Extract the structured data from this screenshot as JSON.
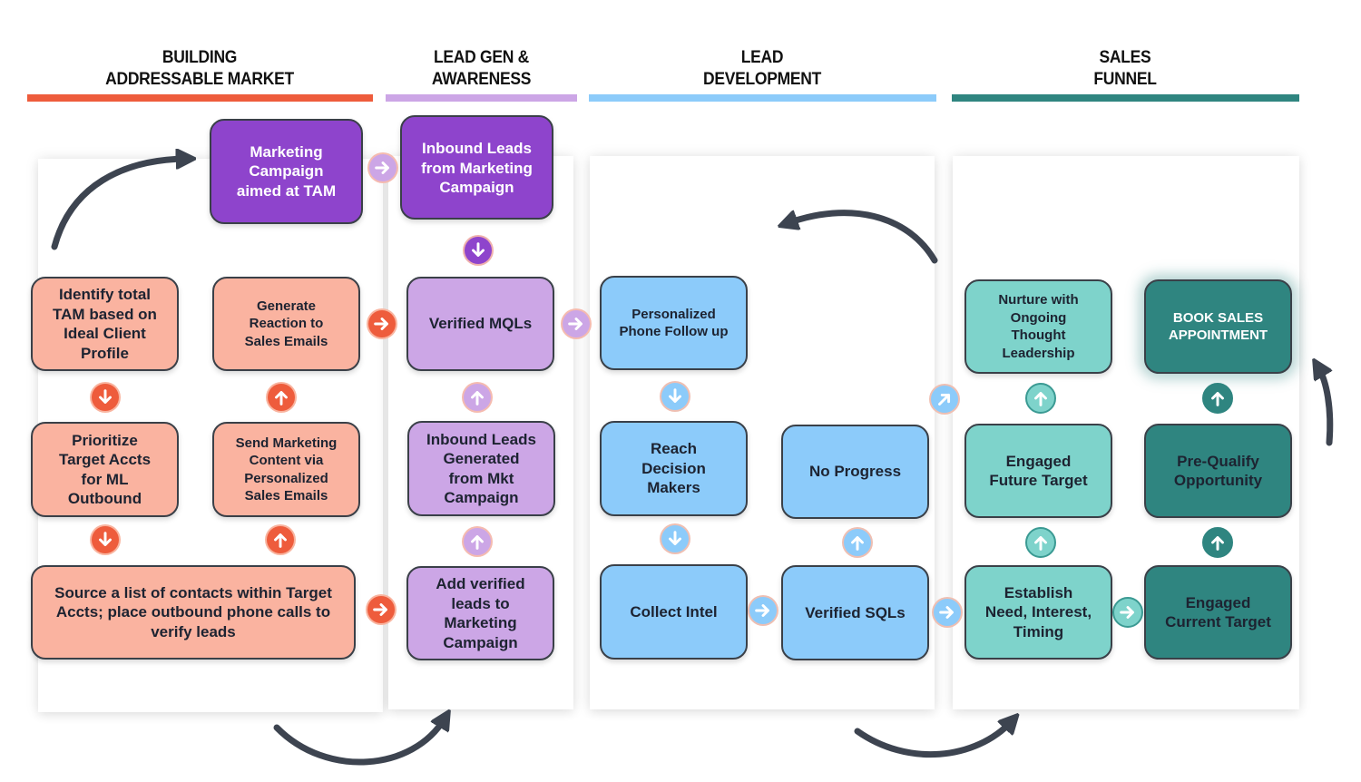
{
  "colors": {
    "stage1": "#EE5C3C",
    "stage2": "#CCA6E6",
    "stage3": "#8CCBFA",
    "stage4": "#2F8580",
    "salmon_box": "#FAB3A0",
    "purple_box": "#8E44CC",
    "light_purple_box": "#CCA6E6",
    "blue_box": "#8CCBFA",
    "light_teal_box": "#7ED3CB",
    "dark_teal_box": "#2F8580",
    "curve_arrow": "#3D4450"
  },
  "stages": [
    {
      "line1": "BUILDING",
      "line2": "ADDRESSABLE MARKET"
    },
    {
      "line1": "LEAD GEN &",
      "line2": "AWARENESS"
    },
    {
      "line1": "LEAD",
      "line2": "DEVELOPMENT"
    },
    {
      "line1": "SALES",
      "line2": "FUNNEL"
    }
  ],
  "boxes": {
    "marketing_campaign": [
      "Marketing",
      "Campaign",
      "aimed at TAM"
    ],
    "inbound_leads_from_campaign": [
      "Inbound Leads",
      "from Marketing",
      "Campaign"
    ],
    "identify_tam": [
      "Identify total",
      "TAM based on",
      "Ideal Client",
      "Profile"
    ],
    "generate_reaction": [
      "Generate",
      "Reaction to",
      "Sales Emails"
    ],
    "verified_mqls": [
      "Verified MQLs"
    ],
    "personalized_phone": [
      "Personalized",
      "Phone Follow up"
    ],
    "nurture": [
      "Nurture with",
      "Ongoing",
      "Thought",
      "Leadership"
    ],
    "book_sales": [
      "BOOK SALES",
      "APPOINTMENT"
    ],
    "prioritize": [
      "Prioritize",
      "Target Accts",
      "for ML",
      "Outbound"
    ],
    "send_marketing": [
      "Send Marketing",
      "Content via",
      "Personalized",
      "Sales Emails"
    ],
    "inbound_generated": [
      "Inbound Leads",
      "Generated",
      "from Mkt",
      "Campaign"
    ],
    "reach_decision": [
      "Reach",
      "Decision",
      "Makers"
    ],
    "no_progress": [
      "No Progress"
    ],
    "engaged_future": [
      "Engaged",
      "Future Target"
    ],
    "pre_qualify": [
      "Pre-Qualify",
      "Opportunity"
    ],
    "source_list": [
      "Source a list of contacts within Target",
      "Accts; place outbound phone calls to",
      "verify leads"
    ],
    "add_verified": [
      "Add verified",
      "leads to",
      "Marketing",
      "Campaign"
    ],
    "collect_intel": [
      "Collect Intel"
    ],
    "verified_sqls": [
      "Verified SQLs"
    ],
    "establish_need": [
      "Establish",
      "Need, Interest,",
      "Timing"
    ],
    "engaged_current": [
      "Engaged",
      "Current Target"
    ]
  },
  "connectors": [
    {
      "id": "campaign-to-inbound",
      "direction": "right",
      "color": "lpurple"
    },
    {
      "id": "inbound-to-mqls",
      "direction": "down",
      "color": "purple"
    },
    {
      "id": "generate-to-mqls",
      "direction": "right",
      "color": "orange"
    },
    {
      "id": "mqls-to-phone",
      "direction": "right",
      "color": "lpurple"
    },
    {
      "id": "identify-to-prioritize",
      "direction": "down",
      "color": "orange"
    },
    {
      "id": "send-to-generate",
      "direction": "up",
      "color": "orange"
    },
    {
      "id": "inbound-gen-to-mqls",
      "direction": "up",
      "color": "lpurple"
    },
    {
      "id": "phone-to-reach",
      "direction": "down",
      "color": "blue"
    },
    {
      "id": "nofprogress-to-nurture",
      "direction": "up-right",
      "color": "blue"
    },
    {
      "id": "future-to-nurture",
      "direction": "up",
      "color": "lteal"
    },
    {
      "id": "prequalify-to-book",
      "direction": "up",
      "color": "dteal"
    },
    {
      "id": "prioritize-to-source",
      "direction": "down",
      "color": "orange"
    },
    {
      "id": "source-to-send",
      "direction": "up",
      "color": "orange"
    },
    {
      "id": "add-to-inbound-gen",
      "direction": "up",
      "color": "lpurple"
    },
    {
      "id": "reach-to-collect",
      "direction": "down",
      "color": "blue"
    },
    {
      "id": "sqls-to-noprogress",
      "direction": "up",
      "color": "blue"
    },
    {
      "id": "establish-to-future",
      "direction": "up",
      "color": "lteal"
    },
    {
      "id": "current-to-prequalify",
      "direction": "up",
      "color": "dteal"
    },
    {
      "id": "source-to-add",
      "direction": "right",
      "color": "orange"
    },
    {
      "id": "collect-to-sqls",
      "direction": "right",
      "color": "blue"
    },
    {
      "id": "sqls-to-establish",
      "direction": "right",
      "color": "blue"
    },
    {
      "id": "establish-to-current",
      "direction": "right",
      "color": "lteal"
    }
  ],
  "curved_arrows": [
    {
      "id": "loop-up-to-campaign",
      "icon": "curved-arrow-icon"
    },
    {
      "id": "loop-back-to-lead-dev",
      "icon": "curved-arrow-icon"
    },
    {
      "id": "loop-bottom-to-lead-gen",
      "icon": "curved-arrow-icon"
    },
    {
      "id": "loop-bottom-to-sales-funnel",
      "icon": "curved-arrow-icon"
    },
    {
      "id": "loop-up-to-book",
      "icon": "curved-arrow-icon"
    }
  ]
}
